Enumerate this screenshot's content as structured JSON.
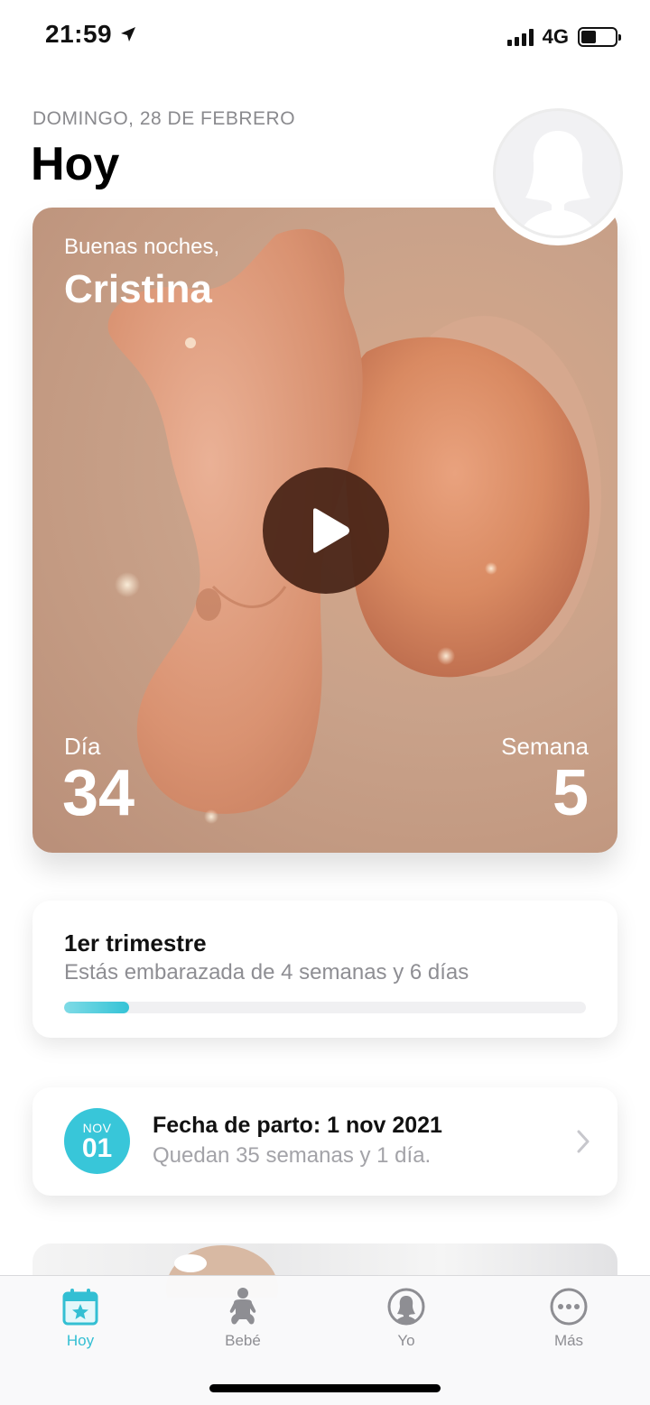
{
  "status_bar": {
    "time": "21:59",
    "network": "4G"
  },
  "header": {
    "date": "DOMINGO, 28 DE FEBRERO",
    "title": "Hoy"
  },
  "hero": {
    "greeting": "Buenas noches,",
    "name": "Cristina",
    "day_label": "Día",
    "day_value": "34",
    "week_label": "Semana",
    "week_value": "5"
  },
  "trimester": {
    "title": "1er trimestre",
    "subtitle": "Estás embarazada de 4 semanas y 6 días",
    "progress": 0.125
  },
  "due_date": {
    "badge_month": "NOV",
    "badge_day": "01",
    "title": "Fecha de parto: 1 nov 2021",
    "subtitle": "Quedan 35 semanas y 1 día."
  },
  "tabs": [
    {
      "label": "Hoy",
      "icon": "calendar-star-icon",
      "active": true
    },
    {
      "label": "Bebé",
      "icon": "baby-icon",
      "active": false
    },
    {
      "label": "Yo",
      "icon": "profile-icon",
      "active": false
    },
    {
      "label": "Más",
      "icon": "more-icon",
      "active": false
    }
  ],
  "colors": {
    "accent": "#33bfd3",
    "hero_bg": "#c9a28a",
    "play_button": "#46231a"
  }
}
